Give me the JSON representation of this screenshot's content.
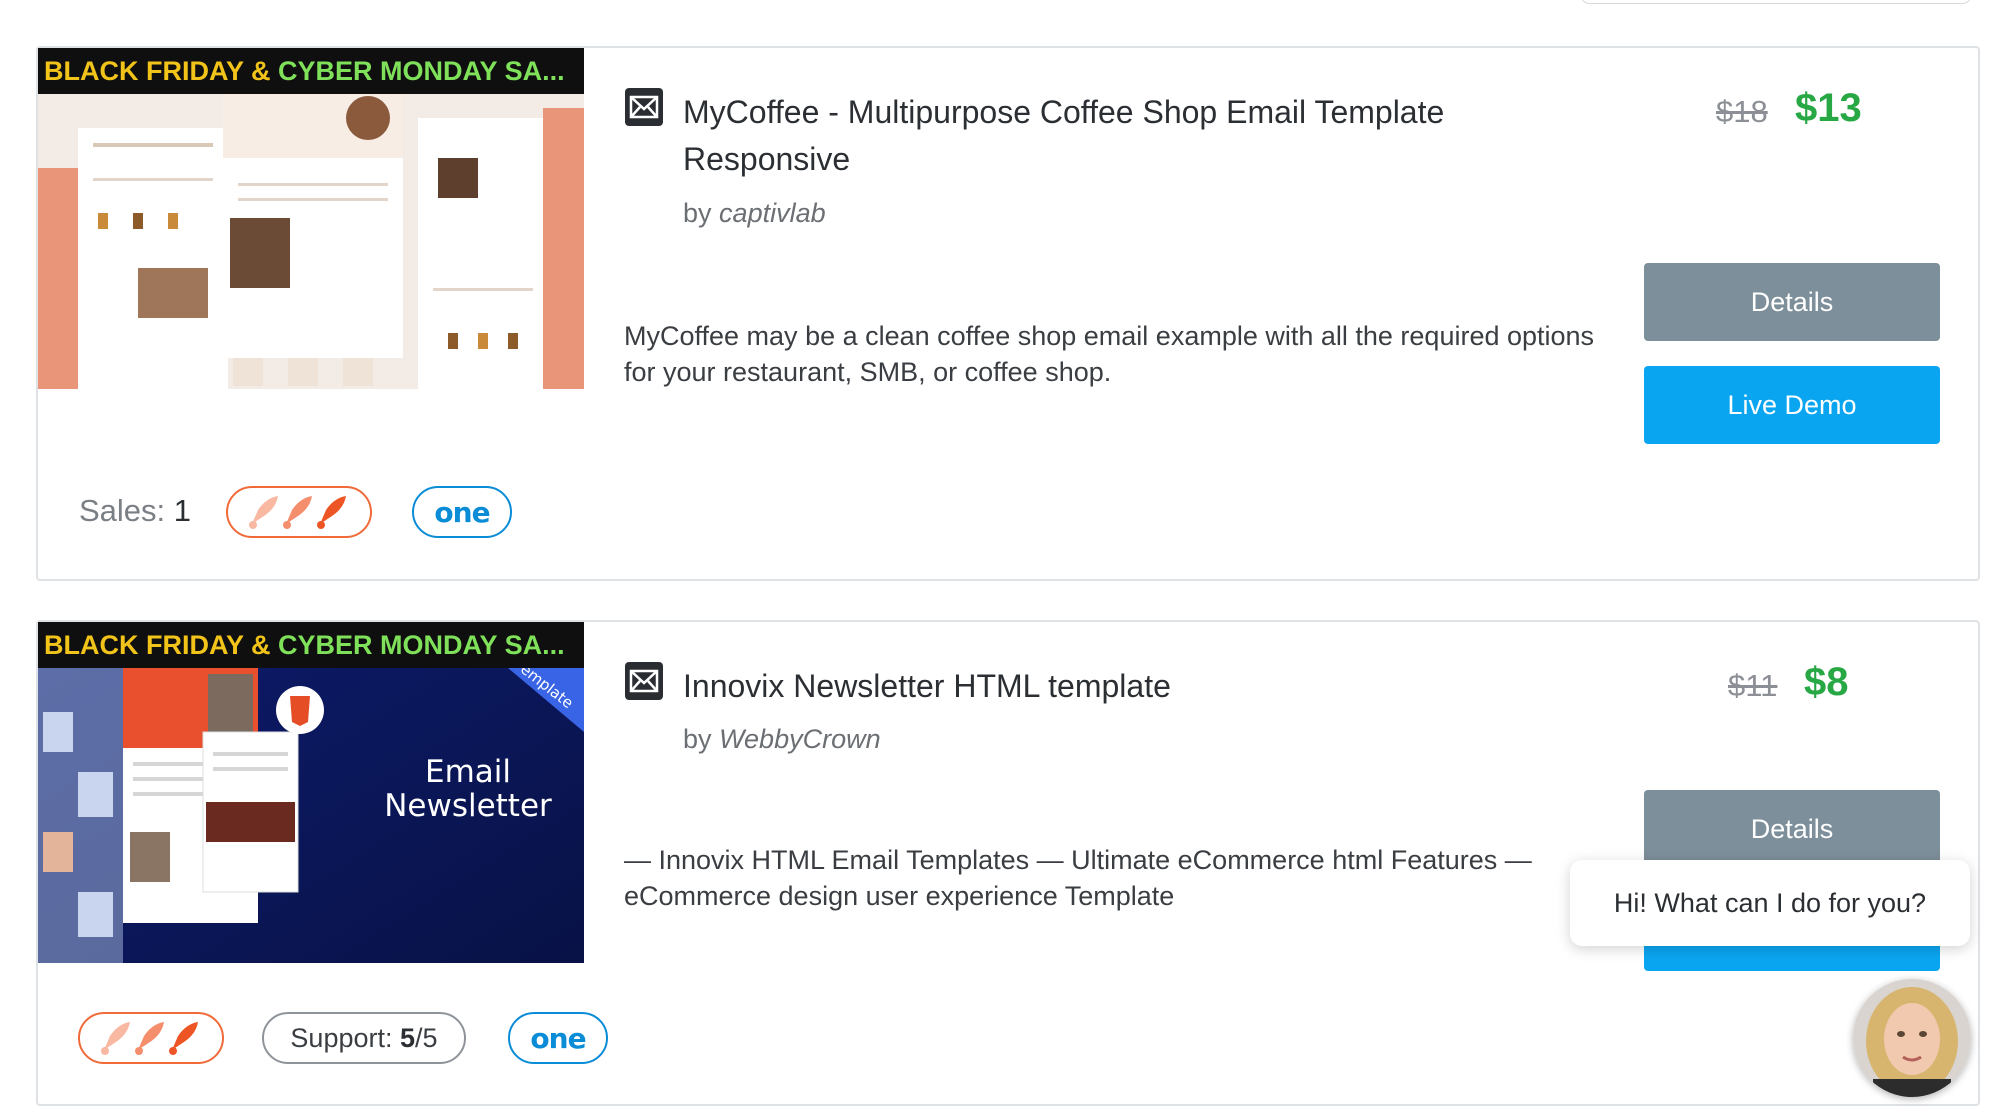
{
  "products": [
    {
      "promo_prefix": "BLACK FRIDAY & ",
      "promo_highlight": "CYBER MONDAY SA...",
      "title": "MyCoffee - Multipurpose Coffee Shop Email Template Responsive",
      "by_label": "by",
      "author": "captivlab",
      "description": "MyCoffee may be a clean coffee shop email example with all the required options for your restaurant, SMB, or coffee shop.",
      "old_price": "$18",
      "new_price": "$13",
      "details_label": "Details",
      "demo_label": "Live Demo",
      "sales_label": "Sales:",
      "sales_value": "1",
      "badge_one": "one"
    },
    {
      "promo_prefix": "BLACK FRIDAY & ",
      "promo_highlight": "CYBER MONDAY SA...",
      "thumb_heading_1": "Email",
      "thumb_heading_2": "Newsletter",
      "thumb_corner": "emplate",
      "title": "Innovix Newsletter HTML template",
      "by_label": "by",
      "author": "WebbyCrown",
      "description": "— Innovix HTML Email Templates — Ultimate eCommerce html Features — eCommerce design user experience Template",
      "old_price": "$11",
      "new_price": "$8",
      "details_label": "Details",
      "support_label": "Support:",
      "support_value": "5",
      "support_max": "/5",
      "badge_one": "one"
    }
  ],
  "chat": {
    "message": "Hi! What can I do for you?"
  },
  "colors": {
    "price_green": "#27a844",
    "details_gray": "#7d8f9a",
    "demo_blue": "#0aa5f0",
    "rocket_orange": "#f06a3a",
    "one_blue": "#0a8cd6"
  }
}
